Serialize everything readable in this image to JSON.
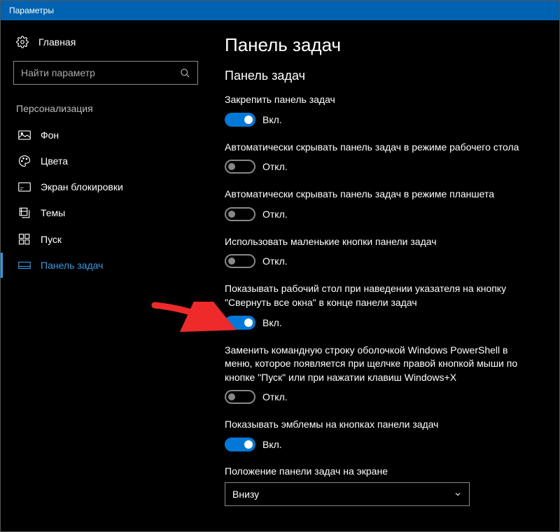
{
  "titlebar": "Параметры",
  "sidebar": {
    "home": "Главная",
    "searchPlaceholder": "Найти параметр",
    "section": "Персонализация",
    "items": [
      {
        "label": "Фон"
      },
      {
        "label": "Цвета"
      },
      {
        "label": "Экран блокировки"
      },
      {
        "label": "Темы"
      },
      {
        "label": "Пуск"
      },
      {
        "label": "Панель задач"
      }
    ]
  },
  "content": {
    "heading": "Панель задач",
    "subheading": "Панель задач",
    "settings": [
      {
        "label": "Закрепить панель задач",
        "state": "on",
        "text": "Вкл."
      },
      {
        "label": "Автоматически скрывать панель задач в режиме рабочего стола",
        "state": "off",
        "text": "Откл."
      },
      {
        "label": "Автоматически скрывать панель задач в режиме планшета",
        "state": "off",
        "text": "Откл."
      },
      {
        "label": "Использовать маленькие кнопки панели задач",
        "state": "off",
        "text": "Откл."
      },
      {
        "label": "Показывать рабочий стол при наведении указателя на кнопку \"Свернуть все окна\" в конце панели задач",
        "state": "on",
        "text": "Вкл."
      },
      {
        "label": "Заменить командную строку оболочкой Windows PowerShell в меню, которое появляется при щелчке правой кнопкой мыши по кнопке \"Пуск\" или при нажатии клавиш Windows+X",
        "state": "off",
        "text": "Откл."
      },
      {
        "label": "Показывать эмблемы на кнопках панели задач",
        "state": "on",
        "text": "Вкл."
      }
    ],
    "positionLabel": "Положение панели задач на экране",
    "positionValue": "Внизу"
  }
}
